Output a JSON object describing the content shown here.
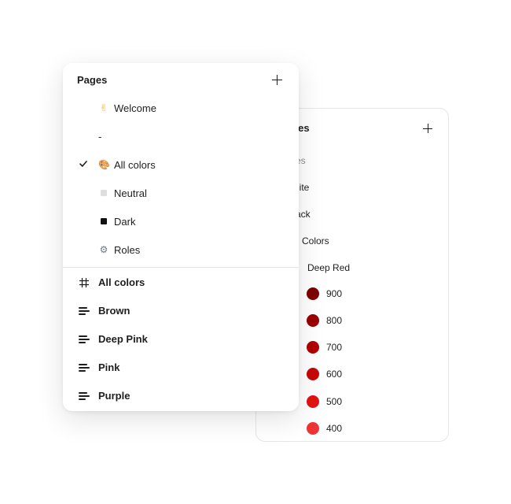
{
  "styles_panel": {
    "title": "tyles",
    "items": [
      {
        "label": "tyles",
        "muted": true
      },
      {
        "label": "hite"
      },
      {
        "label": "ack"
      },
      {
        "label": "Colors"
      },
      {
        "label": "Deep Red"
      }
    ],
    "swatches": [
      {
        "label": "900",
        "color": "#7f0000"
      },
      {
        "label": "800",
        "color": "#9b0000"
      },
      {
        "label": "700",
        "color": "#b10101"
      },
      {
        "label": "600",
        "color": "#c80707"
      },
      {
        "label": "500",
        "color": "#e31212"
      },
      {
        "label": "400",
        "color": "#ee3535"
      }
    ]
  },
  "pages_panel": {
    "title": "Pages",
    "pages": [
      {
        "label": "Welcome",
        "icon": "victory-hand-icon",
        "glyph": "✌"
      },
      {
        "label": "-",
        "icon": "",
        "glyph": ""
      },
      {
        "label": "All colors",
        "icon": "palette-icon",
        "glyph": "🎨",
        "selected": true
      },
      {
        "label": "Neutral",
        "icon": "light-gray-square-icon",
        "glyph": ""
      },
      {
        "label": "Dark",
        "icon": "black-square-icon",
        "glyph": ""
      },
      {
        "label": "Roles",
        "icon": "gear-icon",
        "glyph": "⚙"
      }
    ],
    "layers": [
      {
        "label": "All colors",
        "icon": "frame-hash-icon"
      },
      {
        "label": "Brown",
        "icon": "auto-layout-icon"
      },
      {
        "label": "Deep Pink",
        "icon": "auto-layout-icon"
      },
      {
        "label": "Pink",
        "icon": "auto-layout-icon"
      },
      {
        "label": "Purple",
        "icon": "auto-layout-icon"
      }
    ]
  }
}
